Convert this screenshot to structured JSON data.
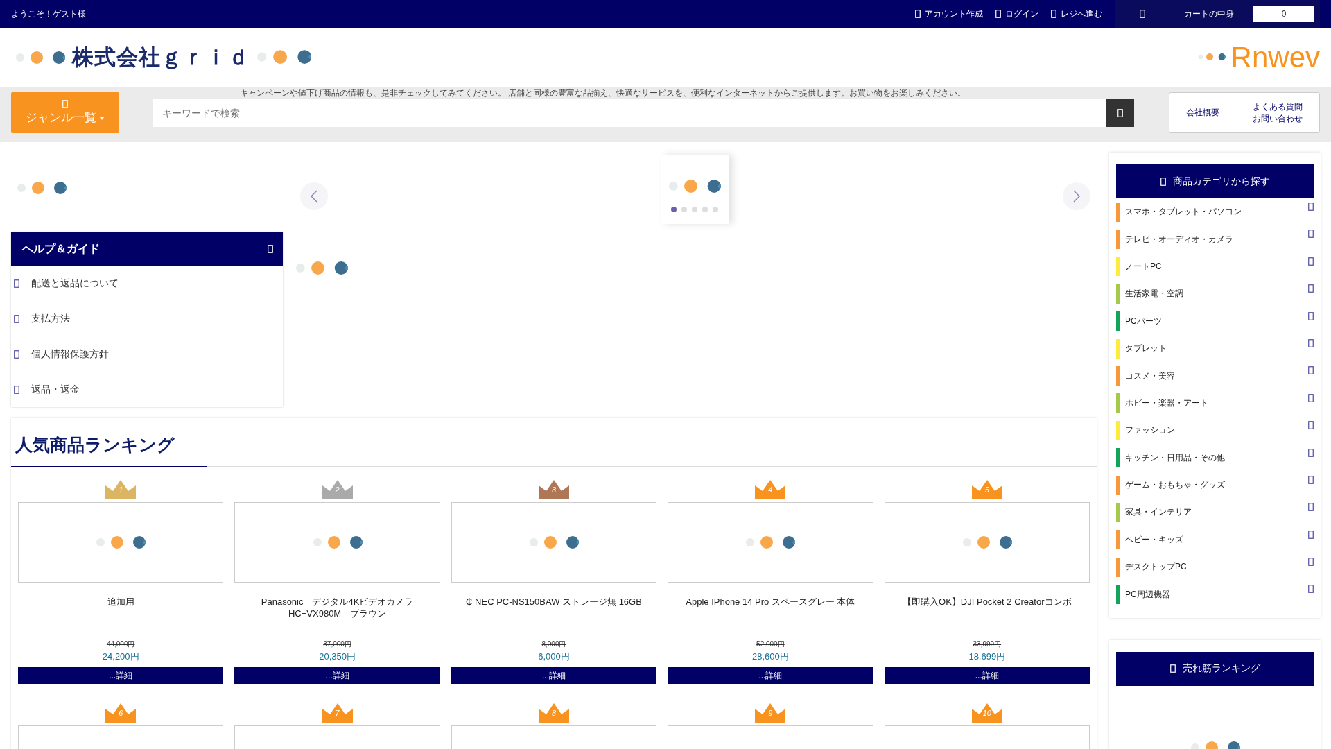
{
  "top_bar": {
    "welcome": "ようこそ！ゲスト様",
    "links": [
      {
        "label": "アカウント作成"
      },
      {
        "label": "ログイン"
      },
      {
        "label": "レジへ進む"
      }
    ],
    "cart_label": "カートの中身",
    "cart_count": "0"
  },
  "header": {
    "company": "株式会社ｇｒｉｄ",
    "brand": "Rnwev"
  },
  "search_bar": {
    "tagline": "キャンペーンや値下げ商品の情報も、是非チェックしてみてください。 店舗と同様の豊富な品揃え、快適なサービスを、便利なインターネットからご提供します。お買い物をお楽しみください。",
    "genre_button": "ジャンル一覧",
    "placeholder": "キーワードで検索",
    "links": [
      {
        "lines": [
          "会社概要"
        ]
      },
      {
        "lines": [
          "よくある質問",
          "お問い合わせ"
        ]
      }
    ]
  },
  "carousel": {
    "pages": [
      {
        "selected": true
      },
      {
        "selected": false
      },
      {
        "selected": false
      },
      {
        "selected": false
      },
      {
        "selected": false
      }
    ]
  },
  "help_guide": {
    "title": "ヘルプ＆ガイド",
    "items": [
      "配送と返品について",
      "支払方法",
      "個人情報保護方針",
      "返品・返金"
    ]
  },
  "ranking": {
    "title": "人気商品ランキング",
    "products": [
      {
        "rank": "1",
        "color": "#dbb562",
        "name": "追加用",
        "old_price": "44,000円",
        "price": "24,200円",
        "button": "...詳細"
      },
      {
        "rank": "2",
        "color": "#aaaaaa",
        "name": "Panasonic　デジタル4Kビデオカメラ HC−VX980M　ブラウン",
        "old_price": "37,000円",
        "price": "20,350円",
        "button": "...詳細"
      },
      {
        "rank": "3",
        "color": "#b07757",
        "name": "₵ NEC PC-NS150BAW ストレージ無 16GB",
        "old_price": "8,000円",
        "price": "6,000円",
        "button": "...詳細"
      },
      {
        "rank": "4",
        "color": "#f7931e",
        "name": "Apple IPhone 14 Pro スペースグレー 本体",
        "old_price": "52,000円",
        "price": "28,600円",
        "button": "...詳細"
      },
      {
        "rank": "5",
        "color": "#f7931e",
        "name": "【即購入OK】DJI Pocket 2 Creatorコンボ",
        "old_price": "33,999円",
        "price": "18,699円",
        "button": "...詳細"
      }
    ],
    "more_ranks": [
      {
        "rank": "6",
        "color": "#f7931e"
      },
      {
        "rank": "7",
        "color": "#f7931e"
      },
      {
        "rank": "8",
        "color": "#f7931e"
      },
      {
        "rank": "9",
        "color": "#f7931e"
      },
      {
        "rank": "10",
        "color": "#f7931e"
      }
    ]
  },
  "category_panel": {
    "title": "商品カテゴリから探す",
    "items": [
      {
        "label": "スマホ・タブレット・パソコン",
        "color": "#f7993a"
      },
      {
        "label": "テレビ・オーディオ・カメラ",
        "color": "#f7993a"
      },
      {
        "label": "ノートPC",
        "color": "#ffeb3b"
      },
      {
        "label": "生活家電・空調",
        "color": "#a5c94a"
      },
      {
        "label": "PCパーツ",
        "color": "#12a55a"
      },
      {
        "label": "タブレット",
        "color": "#ffeb3b"
      },
      {
        "label": "コスメ・美容",
        "color": "#f7993a"
      },
      {
        "label": "ホビー・楽器・アート",
        "color": "#a5c94a"
      },
      {
        "label": "ファッション",
        "color": "#ffeb3b"
      },
      {
        "label": "キッチン・日用品・その他",
        "color": "#12a55a"
      },
      {
        "label": "ゲーム・おもちゃ・グッズ",
        "color": "#f7993a"
      },
      {
        "label": "家具・インテリア",
        "color": "#a5c94a"
      },
      {
        "label": "ベビー・キッズ",
        "color": "#f7993a"
      },
      {
        "label": "デスクトップPC",
        "color": "#f7993a"
      },
      {
        "label": "PC周辺機器",
        "color": "#12a55a"
      }
    ]
  },
  "bestseller_panel": {
    "title": "売れ筋ランキング"
  }
}
